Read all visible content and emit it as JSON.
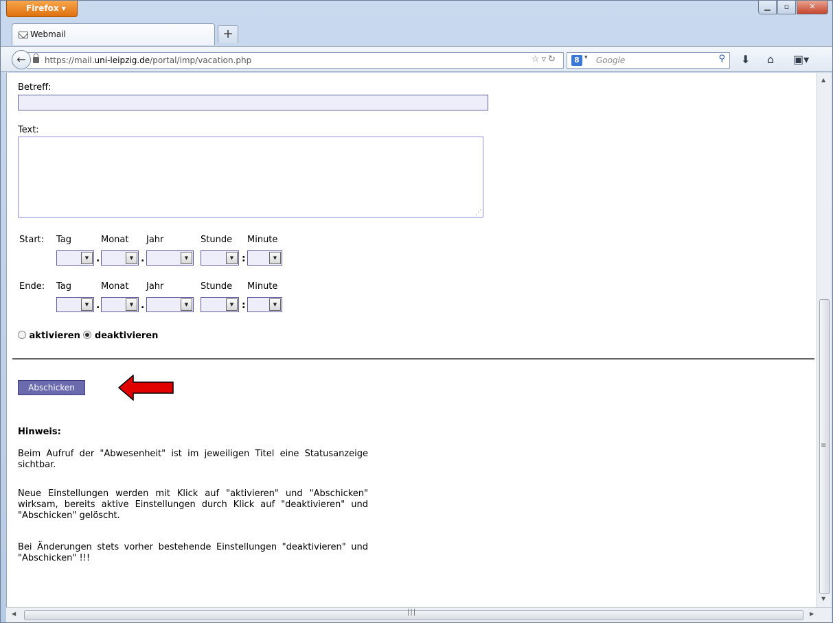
{
  "browser": {
    "menu_button": "Firefox",
    "tab_title": "Webmail",
    "new_tab": "+",
    "url_scheme": "https://mail.",
    "url_host": "uni-leipzig.de",
    "url_path": "/portal/imp/vacation.php",
    "search_placeholder": "Google",
    "search_engine_letter": "8"
  },
  "form": {
    "subject_label": "Betreff:",
    "text_label": "Text:",
    "start_label": "Start:",
    "end_label": "Ende:",
    "day_label": "Tag",
    "month_label": "Monat",
    "year_label": "Jahr",
    "hour_label": "Stunde",
    "minute_label": "Minute",
    "date_sep": ".",
    "time_sep": ":",
    "activate_label": "aktivieren",
    "deactivate_label": "deaktivieren",
    "selected_option": "deaktivieren",
    "submit_label": "Abschicken"
  },
  "notes": {
    "heading": "Hinweis:",
    "p1": "Beim Aufruf der \"Abwesenheit\" ist im jeweiligen Titel eine Statusanzeige sichtbar.",
    "p2": "Neue Einstellungen werden mit Klick auf \"aktivieren\" und \"Abschicken\" wirksam, bereits aktive Einstellungen durch Klick auf \"deaktivieren\" und \"Abschicken\" gelöscht.",
    "p3": "Bei Änderungen stets vorher bestehende Einstellungen \"deaktivieren\" und \"Abschicken\" !!!"
  },
  "colors": {
    "field_bg": "#eeedfa",
    "field_border": "#5d5b9c",
    "submit_bg": "#6b6aae",
    "annotation_arrow": "#e00000"
  },
  "icons": [
    "mail-icon",
    "back-arrow-icon",
    "lock-icon",
    "star-icon",
    "reload-icon",
    "search-icon",
    "download-icon",
    "home-icon",
    "bookmarks-icon",
    "minimize-icon",
    "maximize-icon",
    "close-icon"
  ]
}
